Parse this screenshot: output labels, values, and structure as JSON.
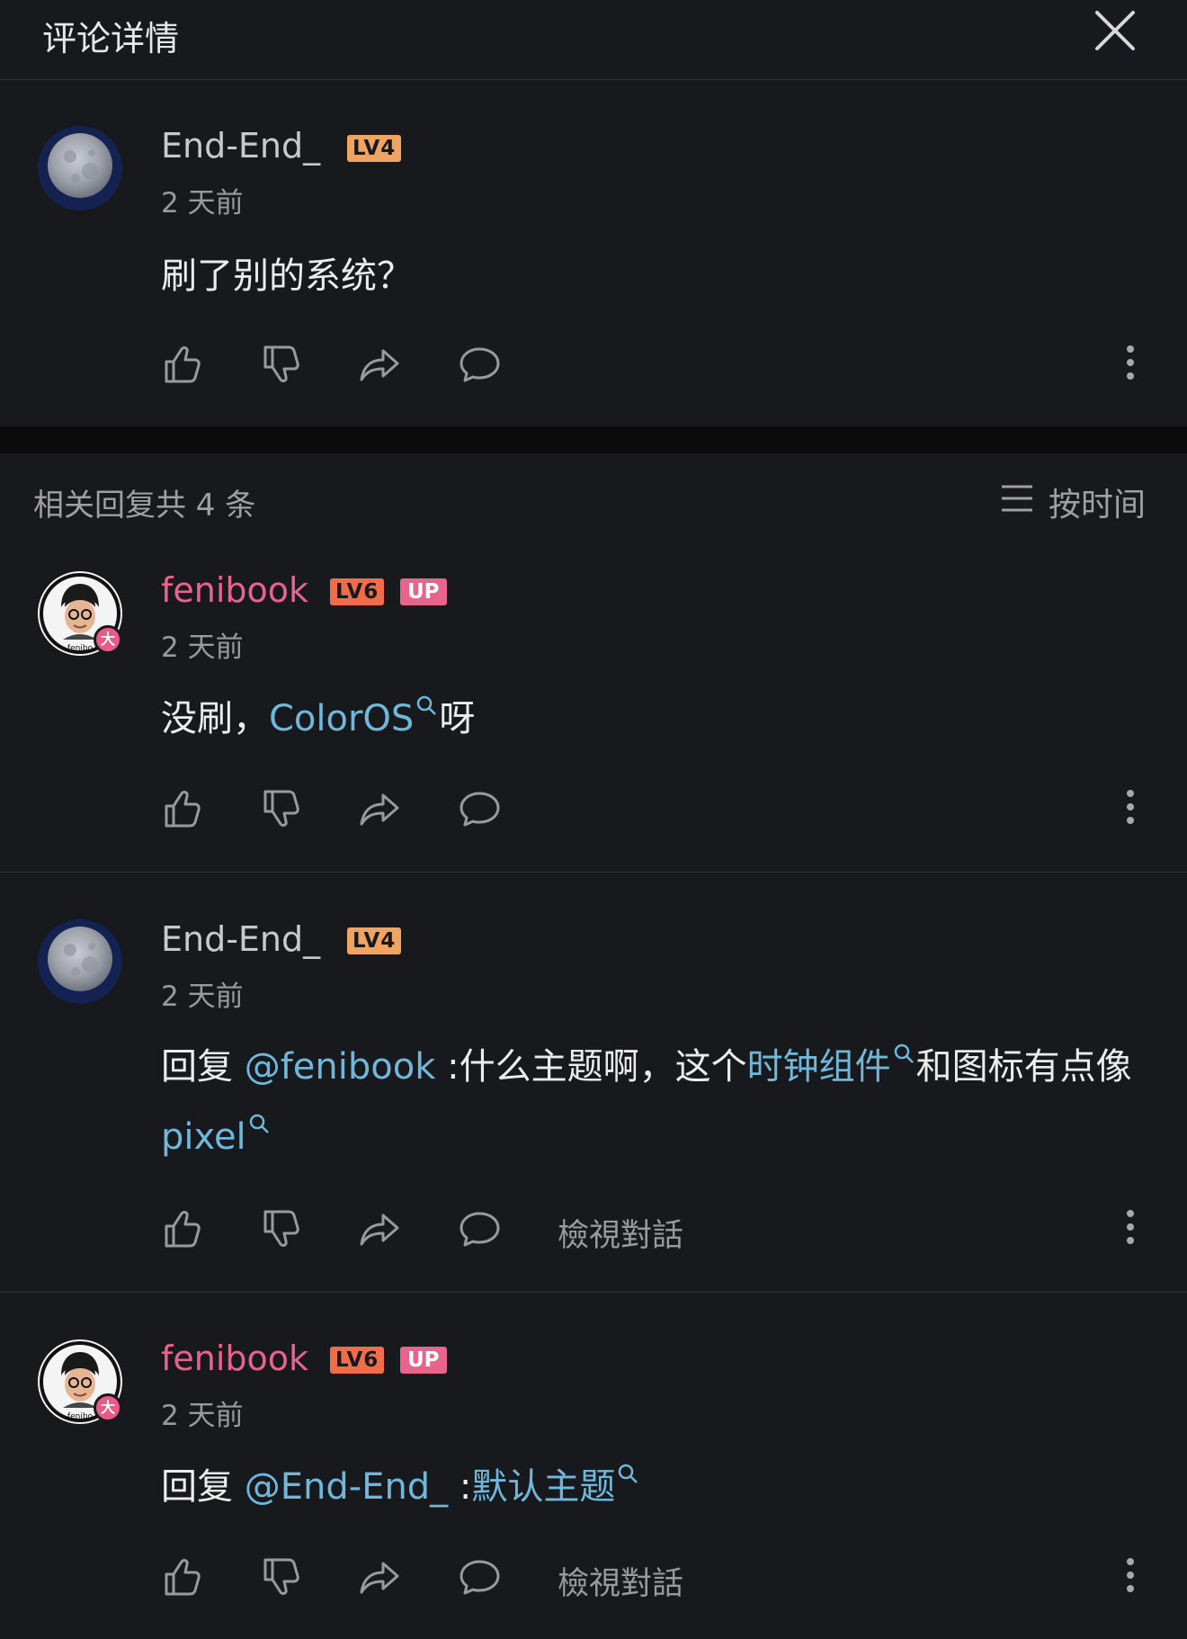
{
  "header": {
    "title": "评论详情"
  },
  "root_comment": {
    "username": "End-End_",
    "level": "LV4",
    "time": "2 天前",
    "text": "刷了别的系统？"
  },
  "replies_header": {
    "count_label": "相关回复共 4 条",
    "sort_label": "按时间"
  },
  "replies": [
    {
      "username": "fenibook",
      "level": "LV6",
      "up_badge": "UP",
      "avatar_badge": "大",
      "time": "2 天前",
      "text_parts": [
        "没刷，",
        "ColorOS",
        "呀"
      ]
    },
    {
      "username": "End-End_",
      "level": "LV4",
      "time": "2 天前",
      "text_parts": [
        "回复 ",
        "@fenibook",
        " :什么主题啊，这个",
        "时钟组件",
        "和图标有点像",
        "pixel"
      ],
      "view_conversation": "檢視對話"
    },
    {
      "username": "fenibook",
      "level": "LV6",
      "up_badge": "UP",
      "avatar_badge": "大",
      "time": "2 天前",
      "text_parts": [
        "回复 ",
        "@End-End_",
        " :",
        "默认主题"
      ],
      "view_conversation": "檢視對話"
    }
  ],
  "icons": {
    "close": "close-icon",
    "like": "thumbs-up-icon",
    "dislike": "thumbs-down-icon",
    "share": "share-icon",
    "reply": "comment-icon",
    "more": "more-vertical-icon",
    "sort": "sort-lines-icon",
    "search": "search-icon"
  },
  "colors": {
    "background": "#18191c",
    "link": "#6fb8dc",
    "up_name": "#e7648c",
    "lv4": "#f0a464",
    "lv6": "#f26d47"
  }
}
